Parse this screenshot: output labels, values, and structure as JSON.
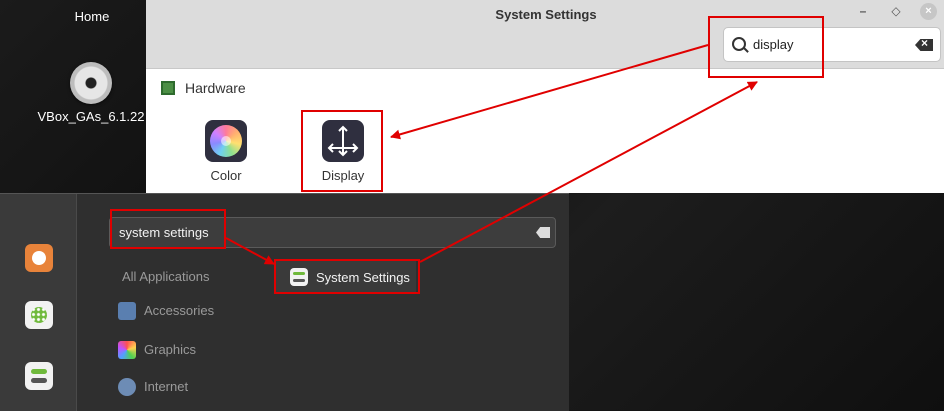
{
  "desktop": {
    "home_label": "Home",
    "disc_label": "VBox_GAs_6.1.22"
  },
  "settings_window": {
    "title": "System Settings",
    "buttons": {
      "minimize": "–",
      "maximize": "◇",
      "close": "×"
    },
    "search": {
      "value": "display"
    },
    "section": "Hardware",
    "tiles": [
      {
        "label": "Color",
        "icon": "color-icon"
      },
      {
        "label": "Display",
        "icon": "display-icon"
      }
    ]
  },
  "menu": {
    "search": {
      "value": "system settings"
    },
    "categories": [
      {
        "label": "All Applications"
      },
      {
        "label": "Accessories",
        "icon": "accessories-icon"
      },
      {
        "label": "Graphics",
        "icon": "graphics-icon"
      },
      {
        "label": "Internet",
        "icon": "internet-icon"
      }
    ],
    "favorites": [
      "firefox-icon",
      "apps-icon",
      "settings-icon"
    ],
    "result": {
      "label": "System Settings",
      "icon": "system-settings-icon"
    }
  },
  "annotation_color": "#e00000"
}
